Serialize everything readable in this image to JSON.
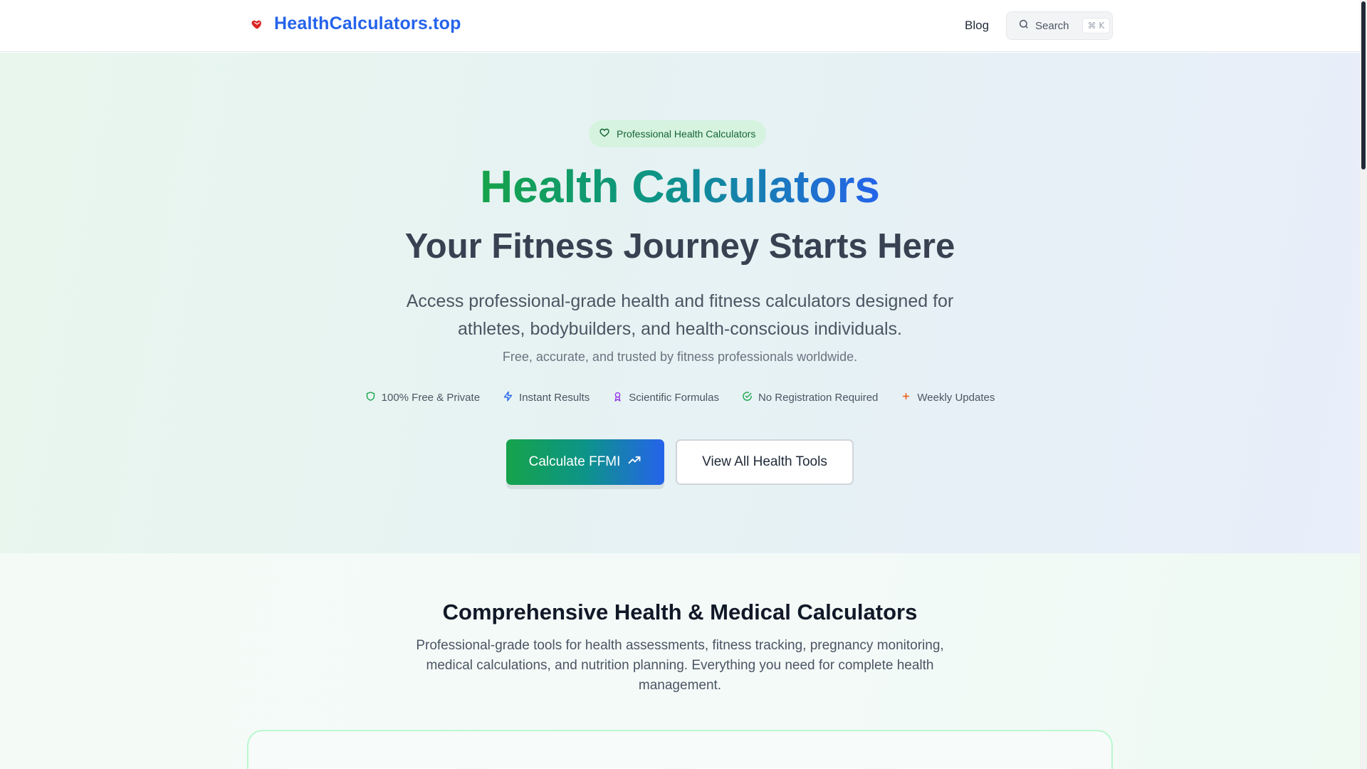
{
  "header": {
    "logo_text": "HealthCalculators.top",
    "logo_icon": "heart-icon",
    "nav_blog": "Blog",
    "search_label": "Search",
    "search_shortcut": "⌘ K"
  },
  "hero": {
    "badge": "Professional Health Calculators",
    "title": "Health Calculators",
    "subtitle": "Your Fitness Journey Starts Here",
    "description": "Access professional-grade health and fitness calculators designed for athletes, bodybuilders, and health-conscious individuals.",
    "tagline": "Free, accurate, and trusted by fitness professionals worldwide.",
    "features": [
      {
        "label": "100% Free & Private",
        "icon": "shield-icon",
        "color": "#16a34a"
      },
      {
        "label": "Instant Results",
        "icon": "zap-icon",
        "color": "#2563eb"
      },
      {
        "label": "Scientific Formulas",
        "icon": "award-icon",
        "color": "#9333ea"
      },
      {
        "label": "No Registration Required",
        "icon": "check-circle-icon",
        "color": "#16a34a"
      },
      {
        "label": "Weekly Updates",
        "icon": "plus-icon",
        "color": "#ea580c"
      }
    ],
    "primary_button": "Calculate FFMI",
    "secondary_button": "View All Health Tools"
  },
  "section": {
    "title": "Comprehensive Health & Medical Calculators",
    "description": "Professional-grade tools for health assessments, fitness tracking, pregnancy monitoring, medical calculations, and nutrition planning. Everything you need for complete health management."
  },
  "colors": {
    "brand_blue": "#2563eb",
    "brand_green": "#16a34a",
    "teal": "#0d9488"
  }
}
